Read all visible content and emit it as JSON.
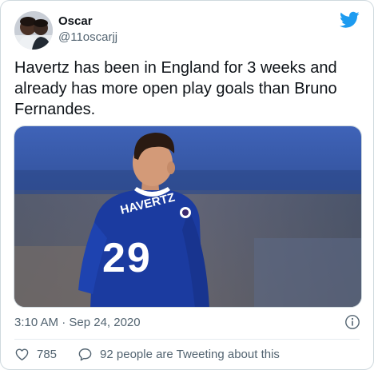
{
  "author": {
    "name": "Oscar",
    "handle": "@11oscarjj",
    "avatar_icon": "profile-avatar"
  },
  "tweet": {
    "text": "Havertz has been in England for 3 weeks and already has more open play goals than Bruno Fernandes.",
    "timestamp": "3:10 AM · Sep 24, 2020"
  },
  "media": {
    "jersey_name": "HAVERTZ",
    "jersey_number": "29"
  },
  "actions": {
    "like_count": "785",
    "conversation_label": "92 people are Tweeting about this"
  },
  "icons": {
    "logo": "twitter-bird-icon",
    "info": "info-icon",
    "like": "heart-icon",
    "reply": "speech-bubble-icon"
  },
  "colors": {
    "twitter_blue": "#1d9bf0",
    "text_primary": "#0f1419",
    "text_secondary": "#536471",
    "border": "#cfd9de",
    "jersey_blue": "#1b3ba0"
  }
}
